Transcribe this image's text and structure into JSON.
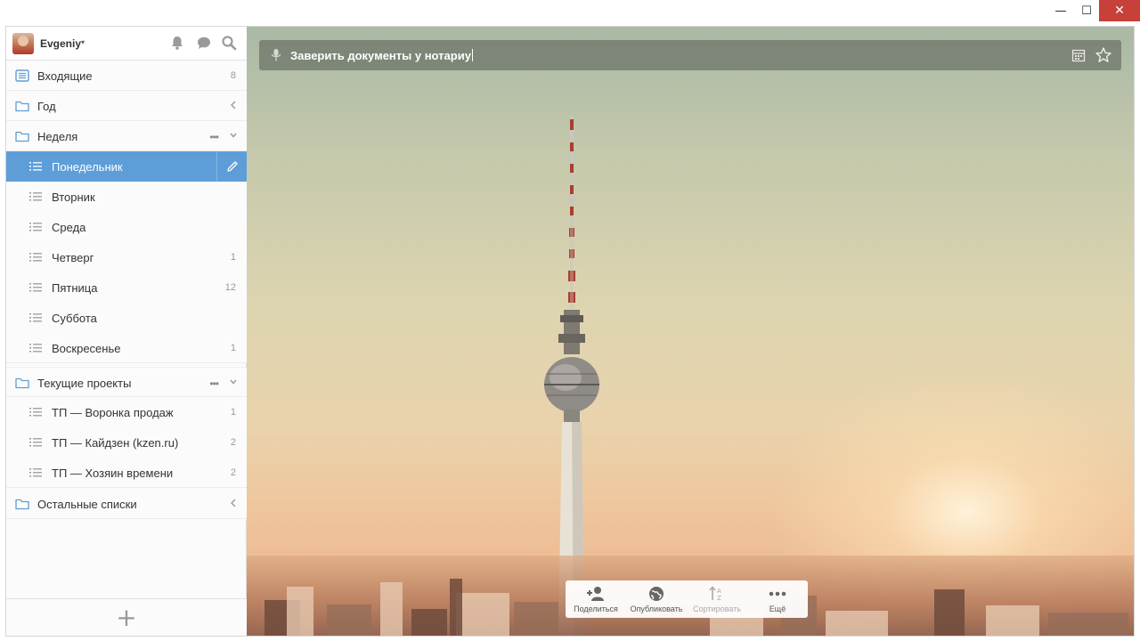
{
  "window": {
    "minimize_glyph": "—",
    "maximize_glyph": "☐",
    "close_glyph": "✕"
  },
  "user": {
    "name": "Evgeniy",
    "caret": "▾"
  },
  "icons": {
    "bell": "bell-icon",
    "chat": "chat-icon",
    "search": "search-icon"
  },
  "sidebar": {
    "inbox": {
      "label": "Входящие",
      "count": "8"
    },
    "year": {
      "label": "Год"
    },
    "week": {
      "label": "Неделя",
      "dots": "•••",
      "items": [
        {
          "label": "Понедельник",
          "count": ""
        },
        {
          "label": "Вторник",
          "count": ""
        },
        {
          "label": "Среда",
          "count": ""
        },
        {
          "label": "Четверг",
          "count": "1"
        },
        {
          "label": "Пятница",
          "count": "12"
        },
        {
          "label": "Суббота",
          "count": ""
        },
        {
          "label": "Воскресенье",
          "count": "1"
        }
      ]
    },
    "projects": {
      "label": "Текущие проекты",
      "dots": "•••",
      "items": [
        {
          "label": "ТП — Воронка продаж",
          "count": "1"
        },
        {
          "label": "ТП — Кайдзен (kzen.ru)",
          "count": "2"
        },
        {
          "label": "ТП — Хозяин времени",
          "count": "2"
        }
      ]
    },
    "other": {
      "label": "Остальные списки"
    },
    "add_glyph": "+"
  },
  "task_input": {
    "value": "Заверить документы у нотариу"
  },
  "toolbar": {
    "share": "Поделиться",
    "publish": "Опубликовать",
    "sort": "Сортировать",
    "more": "Ещё"
  },
  "colors": {
    "accent": "#5e9ed8",
    "close": "#c7403a"
  }
}
